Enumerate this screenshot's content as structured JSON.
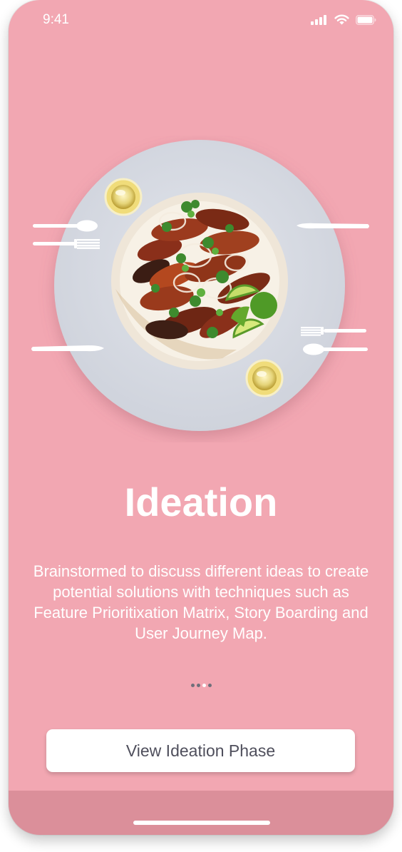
{
  "status_bar": {
    "time": "9:41",
    "icons": [
      "cellular-signal-icon",
      "wifi-icon",
      "battery-icon"
    ]
  },
  "hero": {
    "image": "food-plate-illustration",
    "colors": {
      "background": "#f2a7b2",
      "table_disc": "#d8dbe3",
      "cutlery": "#ffffff"
    }
  },
  "content": {
    "title": "Ideation",
    "description": "Brainstormed to discuss different ideas to create potential solutions with techniques such as Feature Prioritixation Matrix, Story Boarding and User Journey Map."
  },
  "pagination": {
    "total": 4,
    "active_index": 2
  },
  "cta": {
    "label": "View Ideation Phase"
  },
  "colors": {
    "screen_background": "#f2a7b2",
    "bottom_band": "#db8f9a",
    "button_text": "#4f4f5c"
  }
}
